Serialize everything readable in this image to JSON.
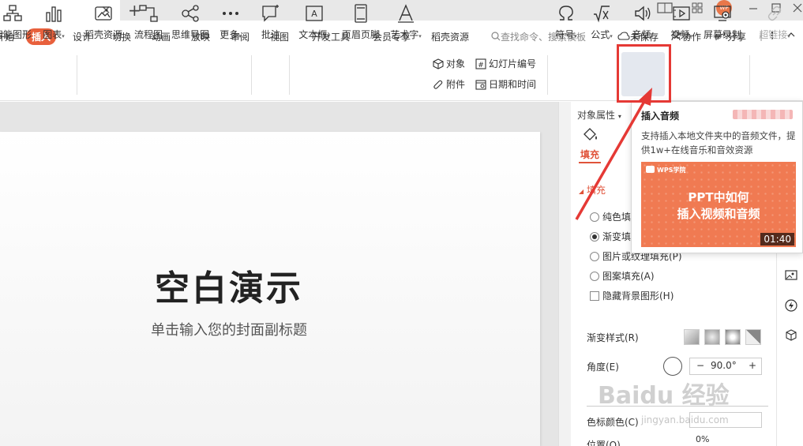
{
  "titlebar": {
    "close_glyph": "✕",
    "add_glyph": "+",
    "avatar_text": "WP"
  },
  "menu": {
    "items": [
      "开始",
      "插入",
      "设计",
      "切换",
      "动画",
      "放映",
      "审阅",
      "视图",
      "开发工具",
      "会员专享",
      "稻壳资源"
    ],
    "active": "插入",
    "search_placeholder": "查找命令、搜索模板",
    "unsaved": "未保存",
    "collab": "协作",
    "share": "分享"
  },
  "ribbon": {
    "smartart": "智能图形",
    "chart": "图表",
    "docer": "稻壳资源",
    "flowchart": "流程图",
    "mindmap": "思维导图",
    "more": "更多",
    "comment": "批注",
    "textbox": "文本框",
    "header_footer": "页眉页脚",
    "wordart": "艺术字",
    "object": "对象",
    "attachment": "附件",
    "slide_number": "幻灯片编号",
    "datetime": "日期和时间",
    "symbol": "符号",
    "formula": "公式",
    "audio": "音频",
    "video": "视频",
    "screen_record": "屏幕录制",
    "hyperlink": "超链接"
  },
  "slide": {
    "title": "空白演示",
    "subtitle": "单击输入您的封面副标题"
  },
  "panel": {
    "header": "对象属性",
    "fill_tab": "填充",
    "section": "填充",
    "options": [
      {
        "label": "纯色填",
        "checked": false
      },
      {
        "label": "渐变填",
        "checked": true
      },
      {
        "label": "图片或纹理填充(P)",
        "checked": false
      },
      {
        "label": "图案填充(A)",
        "checked": false
      }
    ],
    "hide_bg": "隐藏背景图形(H)",
    "grad_style": "渐变样式(R)",
    "angle_label": "角度(E)",
    "angle_value": "90.0°",
    "stop_color": "色标颜色(C)",
    "position": "位置(O)",
    "position_value": "0%"
  },
  "tooltip": {
    "title": "插入音频",
    "desc": "支持插入本地文件夹中的音频文件，提供1w+在线音乐和音效资源",
    "brand": "WPS学院",
    "video_line1": "PPT中如何",
    "video_line2": "插入视频和音频",
    "duration": "01:40"
  },
  "watermark": {
    "text": "Baidu 经验",
    "sub": "jingyan.baidu.com"
  },
  "colors": {
    "accent": "#e8603c",
    "highlight_box": "#e53935",
    "video_bg": "#f07a52"
  }
}
